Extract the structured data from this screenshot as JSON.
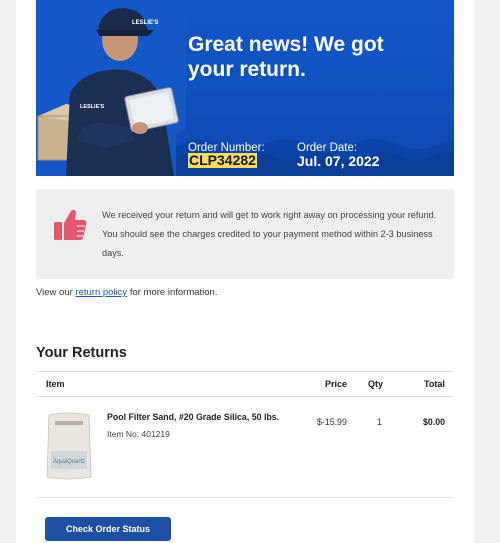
{
  "hero": {
    "headline_line1": "Great news! We got",
    "headline_line2": "your return.",
    "order_number_label": "Order Number:",
    "order_number": "CLP34282",
    "order_date_label": "Order Date:",
    "order_date": "Jul. 07, 2022",
    "brand_cap_text": "LESLIE'S",
    "brand_shirt_text": "LESLIE'S"
  },
  "notice": {
    "icon": "thumbs-up-icon",
    "text": "We received your return and will get to work right away on processing your refund. You should see the charges credited to your payment method within 2-3 business days."
  },
  "policy": {
    "prefix": "View our ",
    "link_text": "return policy",
    "suffix": " for more information."
  },
  "returns": {
    "title": "Your Returns",
    "columns": {
      "item": "Item",
      "price": "Price",
      "qty": "Qty",
      "total": "Total"
    },
    "items": [
      {
        "name": "Pool Filter Sand, #20 Grade Silica, 50 lbs.",
        "item_no": "Item No: 401219",
        "price": "$-15.99",
        "qty": "1",
        "total": "$0.00",
        "package_label": "AquaQuartz"
      }
    ]
  },
  "cta": {
    "label": "Check Order Status"
  },
  "colors": {
    "hero_blue": "#1357c9",
    "highlight": "#f7dd5a",
    "thumb": "#e8566d",
    "button": "#1d4fa3",
    "link": "#2359b3"
  }
}
